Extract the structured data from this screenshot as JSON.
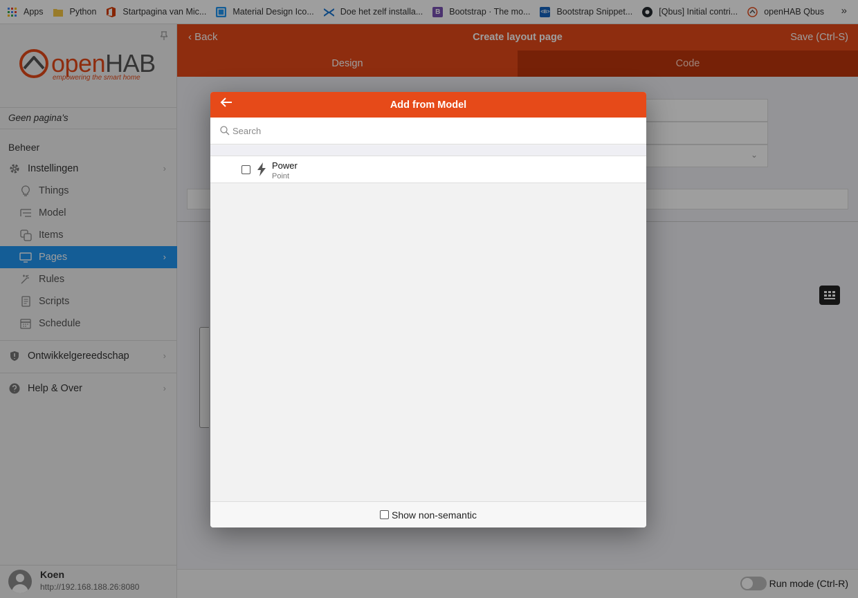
{
  "bookmarks": [
    {
      "label": "Apps",
      "icon": "apps-grid-icon",
      "color": "#4285f4"
    },
    {
      "label": "Python",
      "icon": "folder-icon",
      "color": "#f6c744"
    },
    {
      "label": "Startpagina van Mic...",
      "icon": "office-icon",
      "color": "#d83b01"
    },
    {
      "label": "Material Design Ico...",
      "icon": "material-design-icon",
      "color": "#2196f3"
    },
    {
      "label": "Doe het zelf installa...",
      "icon": "tools-icon",
      "color": "#1976d2"
    },
    {
      "label": "Bootstrap · The mo...",
      "icon": "bootstrap-icon",
      "color": "#7952b3"
    },
    {
      "label": "Bootstrap Snippet...",
      "icon": "bootstrap-snippets-icon",
      "color": "#1565c0"
    },
    {
      "label": "[Qbus] Initial contri...",
      "icon": "github-icon",
      "color": "#24292e"
    },
    {
      "label": "openHAB Qbus",
      "icon": "openhab-icon",
      "color": "#e64a19"
    }
  ],
  "sidebar": {
    "logo_text_a": "open",
    "logo_text_b": "HAB",
    "logo_sub": "empowering the smart home",
    "no_pages": "Geen pagina's",
    "section": "Beheer",
    "settings": "Instellingen",
    "sub_items": [
      {
        "label": "Things",
        "icon": "lightbulb-icon"
      },
      {
        "label": "Model",
        "icon": "list-tree-icon"
      },
      {
        "label": "Items",
        "icon": "items-squares-icon"
      },
      {
        "label": "Pages",
        "icon": "monitor-icon"
      },
      {
        "label": "Rules",
        "icon": "magic-wand-icon"
      },
      {
        "label": "Scripts",
        "icon": "document-icon"
      },
      {
        "label": "Schedule",
        "icon": "calendar-icon"
      }
    ],
    "dev_tools": "Ontwikkelgereedschap",
    "help": "Help & Over",
    "user_name": "Koen",
    "user_url": "http://192.168.188.26:8080"
  },
  "navbar": {
    "back": "Back",
    "title": "Create layout page",
    "save": "Save (Ctrl-S)"
  },
  "tabs": {
    "design": "Design",
    "code": "Code"
  },
  "bottom": {
    "run_mode": "Run mode (Ctrl-R)"
  },
  "modal": {
    "title": "Add from Model",
    "search_placeholder": "Search",
    "item_title": "Power",
    "item_sub": "Point",
    "show_non_semantic": "Show non-semantic"
  },
  "colors": {
    "accent": "#e64a19",
    "accent_dark": "#bf360c",
    "active_nav": "#2196f3"
  }
}
